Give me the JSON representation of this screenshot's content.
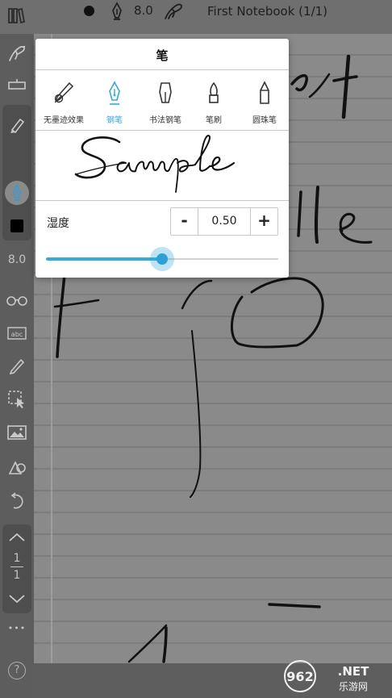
{
  "topbar": {
    "pen_size": "8.0",
    "notebook_title": "First Notebook (1/1)"
  },
  "sidebar": {
    "pen_size": "8.0",
    "page_current": "1",
    "page_total": "1",
    "help_label": "?",
    "more_label": "•••"
  },
  "popup": {
    "title": "笔",
    "pen_types": [
      {
        "label": "无墨迹效果",
        "icon": "no-ink-pen-icon"
      },
      {
        "label": "钢笔",
        "icon": "fountain-pen-icon"
      },
      {
        "label": "书法钢笔",
        "icon": "calligraphy-pen-icon"
      },
      {
        "label": "笔刷",
        "icon": "brush-icon"
      },
      {
        "label": "圆珠笔",
        "icon": "ballpoint-pen-icon"
      }
    ],
    "selected_pen": "钢笔",
    "wetness_label": "湿度",
    "wetness_value": "0.50",
    "minus_label": "-",
    "plus_label": "+",
    "slider_fraction": 0.5
  },
  "watermark": {
    "brand": "962.NET",
    "subtitle": "乐游网"
  },
  "colors": {
    "accent": "#35a8dc",
    "ink": "#111111",
    "selected_color": "#000000"
  }
}
